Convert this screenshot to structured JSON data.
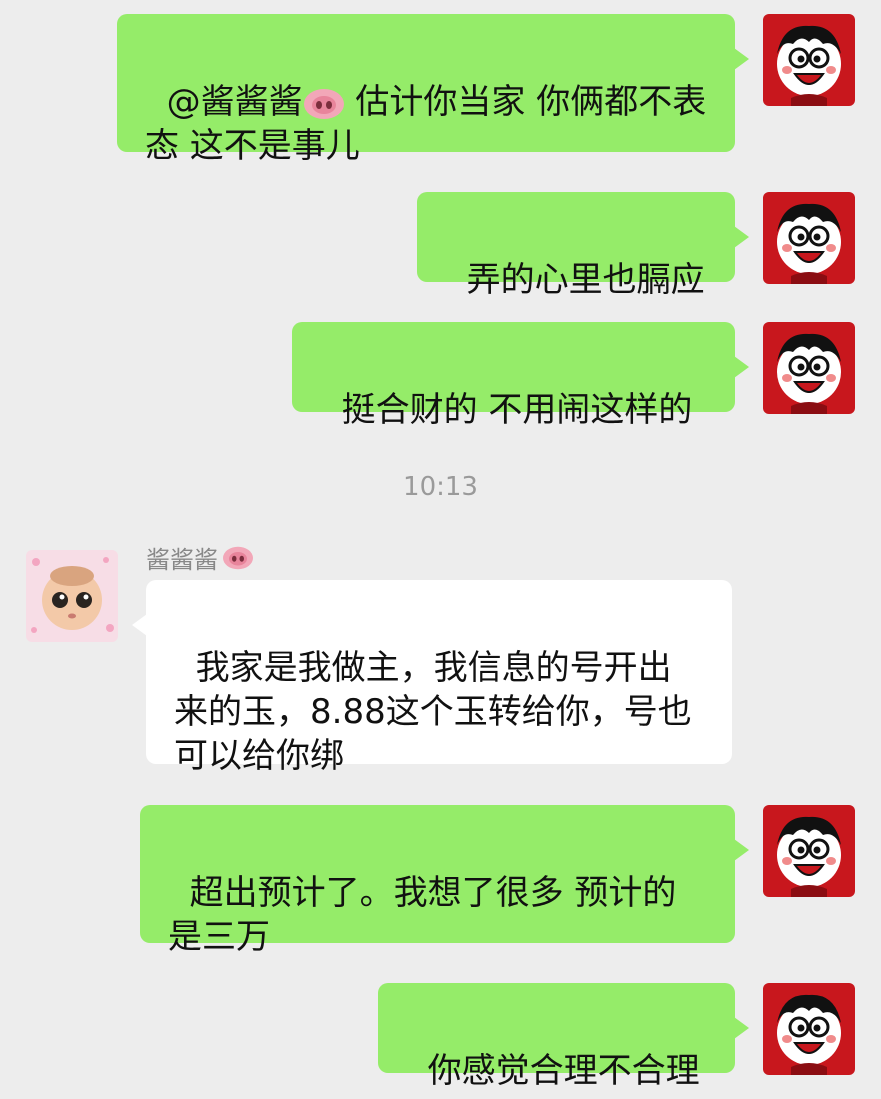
{
  "messages": [
    {
      "side": "out",
      "text_before_icon": "@酱酱酱",
      "text_after_icon": " 估计你当家 你俩都不表态 这不是事儿"
    },
    {
      "side": "out",
      "text": "弄的心里也膈应"
    },
    {
      "side": "out",
      "text": "挺合财的 不用闹这样的"
    },
    {
      "side": "in",
      "sender": "酱酱酱",
      "text": "我家是我做主，我信息的号开出来的玉，8.88这个玉转给你，号也可以给你绑"
    },
    {
      "side": "out",
      "text": "超出预计了。我想了很多 预计的是三万"
    },
    {
      "side": "out",
      "text": "你感觉合理不合理"
    }
  ],
  "timestamp": "10:13",
  "icons": {
    "own_avatar": "cartoon-boy-avatar-icon",
    "other_avatar": "baby-face-avatar-icon",
    "mention_emoji": "pig-nose-emoji-icon"
  },
  "colors": {
    "background": "#ededed",
    "outgoing_bubble": "#95ec69",
    "incoming_bubble": "#ffffff",
    "avatar_red": "#c8171d"
  }
}
